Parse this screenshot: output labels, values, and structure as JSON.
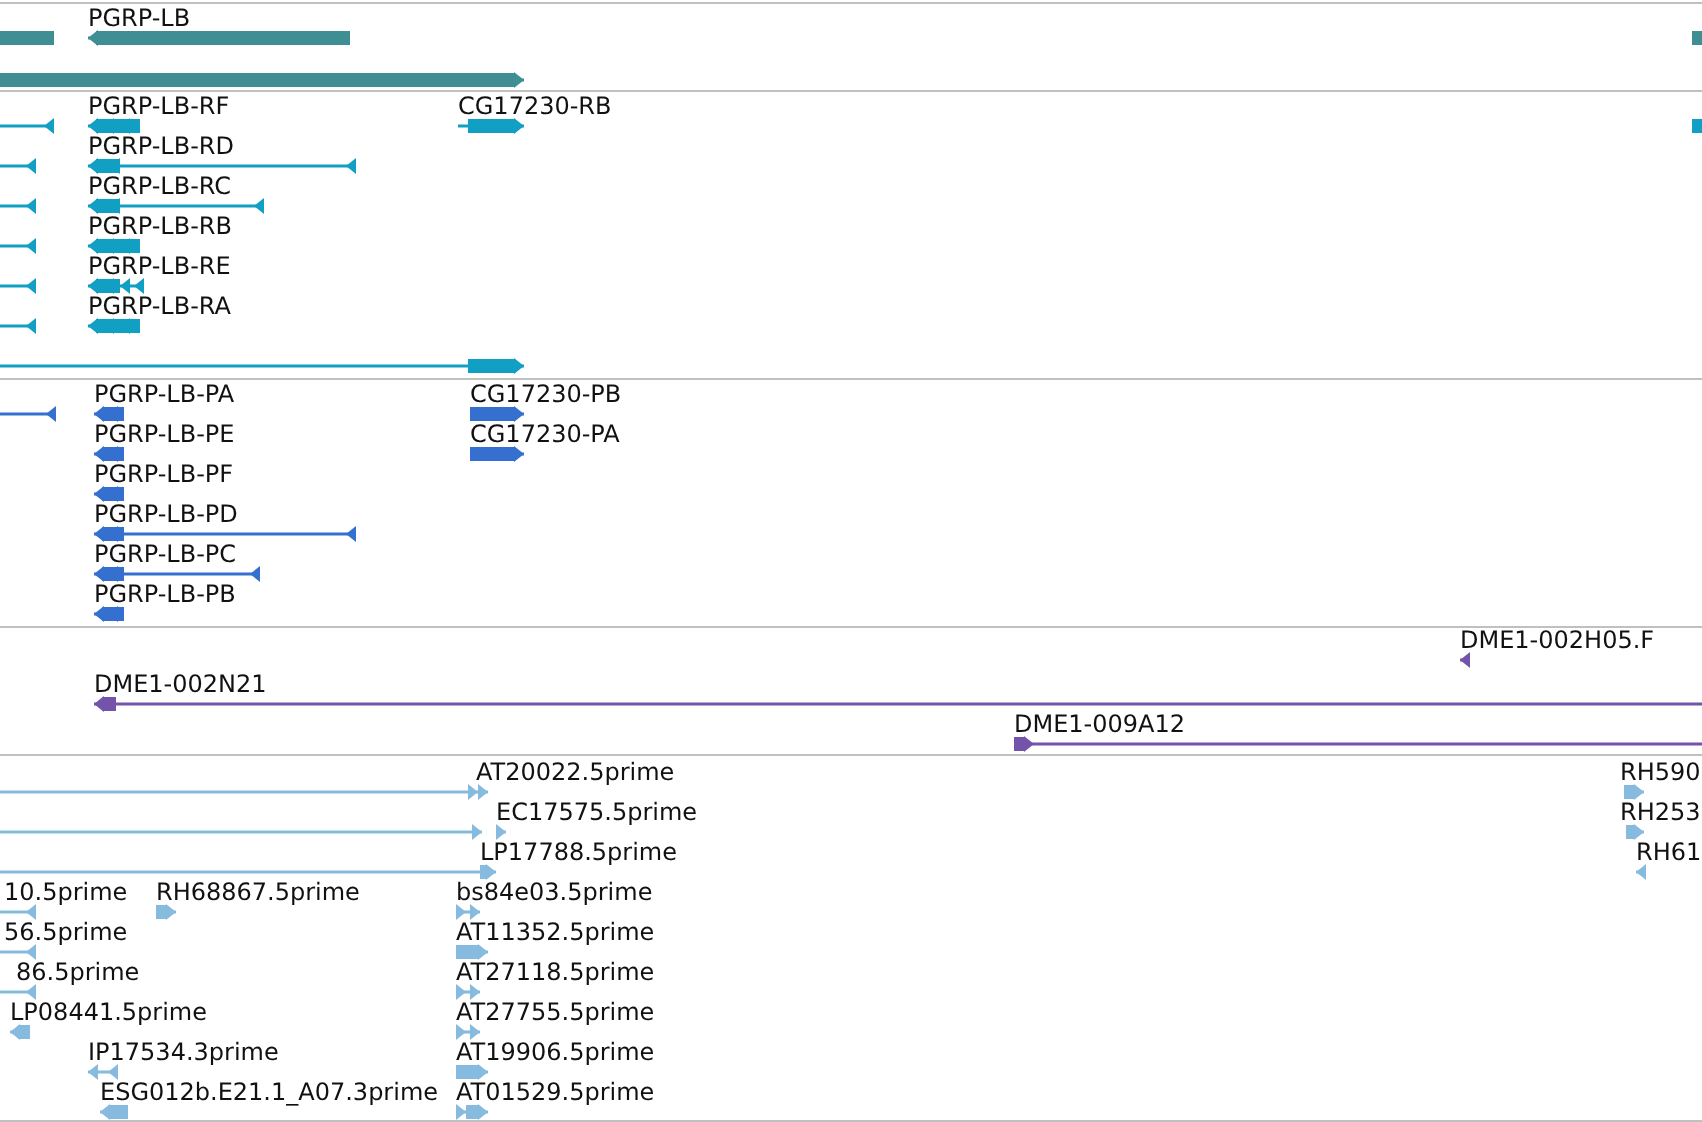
{
  "tracks": [
    {
      "color": "#3f8e93",
      "features": [
        {
          "arrow": false
        },
        {
          "label": "PGRP-LB",
          "reverse": true
        },
        {
          "reverse": false
        },
        {
          "arrow": false
        }
      ]
    },
    {
      "color": "#119fc4",
      "features": [
        {
          "reverse": true
        },
        {
          "label": "PGRP-LB-RF",
          "reverse": true
        },
        {
          "label": "CG17230-RB",
          "reverse": false
        },
        {
          "arrow": false
        },
        {
          "reverse": true
        },
        {
          "label": "PGRP-LB-RD",
          "reverse": true
        },
        {
          "reverse": true
        },
        {
          "label": "PGRP-LB-RC",
          "reverse": true
        },
        {
          "reverse": true
        },
        {
          "label": "PGRP-LB-RB",
          "reverse": true
        },
        {
          "reverse": true
        },
        {
          "label": "PGRP-LB-RE",
          "reverse": true
        },
        {
          "reverse": true
        },
        {
          "label": "PGRP-LB-RA",
          "reverse": true
        },
        {
          "reverse": false
        }
      ]
    },
    {
      "color": "#356fcf",
      "features": [
        {
          "reverse": true
        },
        {
          "label": "PGRP-LB-PA",
          "reverse": true
        },
        {
          "label": "CG17230-PB",
          "reverse": false
        },
        {
          "label": "PGRP-LB-PE",
          "reverse": true
        },
        {
          "label": "CG17230-PA",
          "reverse": false
        },
        {
          "label": "PGRP-LB-PF",
          "reverse": true
        },
        {
          "label": "PGRP-LB-PD",
          "reverse": true
        },
        {
          "label": "PGRP-LB-PC",
          "reverse": true
        },
        {
          "label": "PGRP-LB-PB",
          "reverse": true
        }
      ]
    },
    {
      "color": "#7454aa",
      "features": [
        {
          "label": "DME1-002H05.F",
          "reverse": true
        },
        {
          "label": "DME1-002N21",
          "reverse": true
        },
        {
          "label": "DME1-009A12",
          "reverse": false
        }
      ]
    },
    {
      "color": "#86bade",
      "features": [
        {
          "label": "AT20022.5prime",
          "reverse": false
        },
        {
          "label": "RH590",
          "reverse": false
        },
        {
          "reverse": false
        },
        {
          "label": "EC17575.5prime",
          "reverse": false
        },
        {
          "label": "RH253",
          "reverse": false
        },
        {
          "label": "LP17788.5prime",
          "reverse": false
        },
        {
          "label": "RH61",
          "reverse": true
        },
        {
          "label": "10.5prime",
          "reverse": true
        },
        {
          "label": "RH68867.5prime",
          "reverse": false
        },
        {
          "label": "bs84e03.5prime",
          "reverse": false
        },
        {
          "label": "56.5prime",
          "reverse": true
        },
        {
          "label": "AT11352.5prime",
          "reverse": false
        },
        {
          "label": "86.5prime",
          "reverse": true
        },
        {
          "label": "AT27118.5prime",
          "reverse": false
        },
        {
          "label": "LP08441.5prime",
          "reverse": true
        },
        {
          "label": "AT27755.5prime",
          "reverse": false
        },
        {
          "label": "IP17534.3prime",
          "reverse": true
        },
        {
          "label": "AT19906.5prime",
          "reverse": false
        },
        {
          "label": "ESG012b.E21.1_A07.3prime",
          "reverse": true
        },
        {
          "label": "AT01529.5prime",
          "reverse": false
        }
      ]
    }
  ]
}
